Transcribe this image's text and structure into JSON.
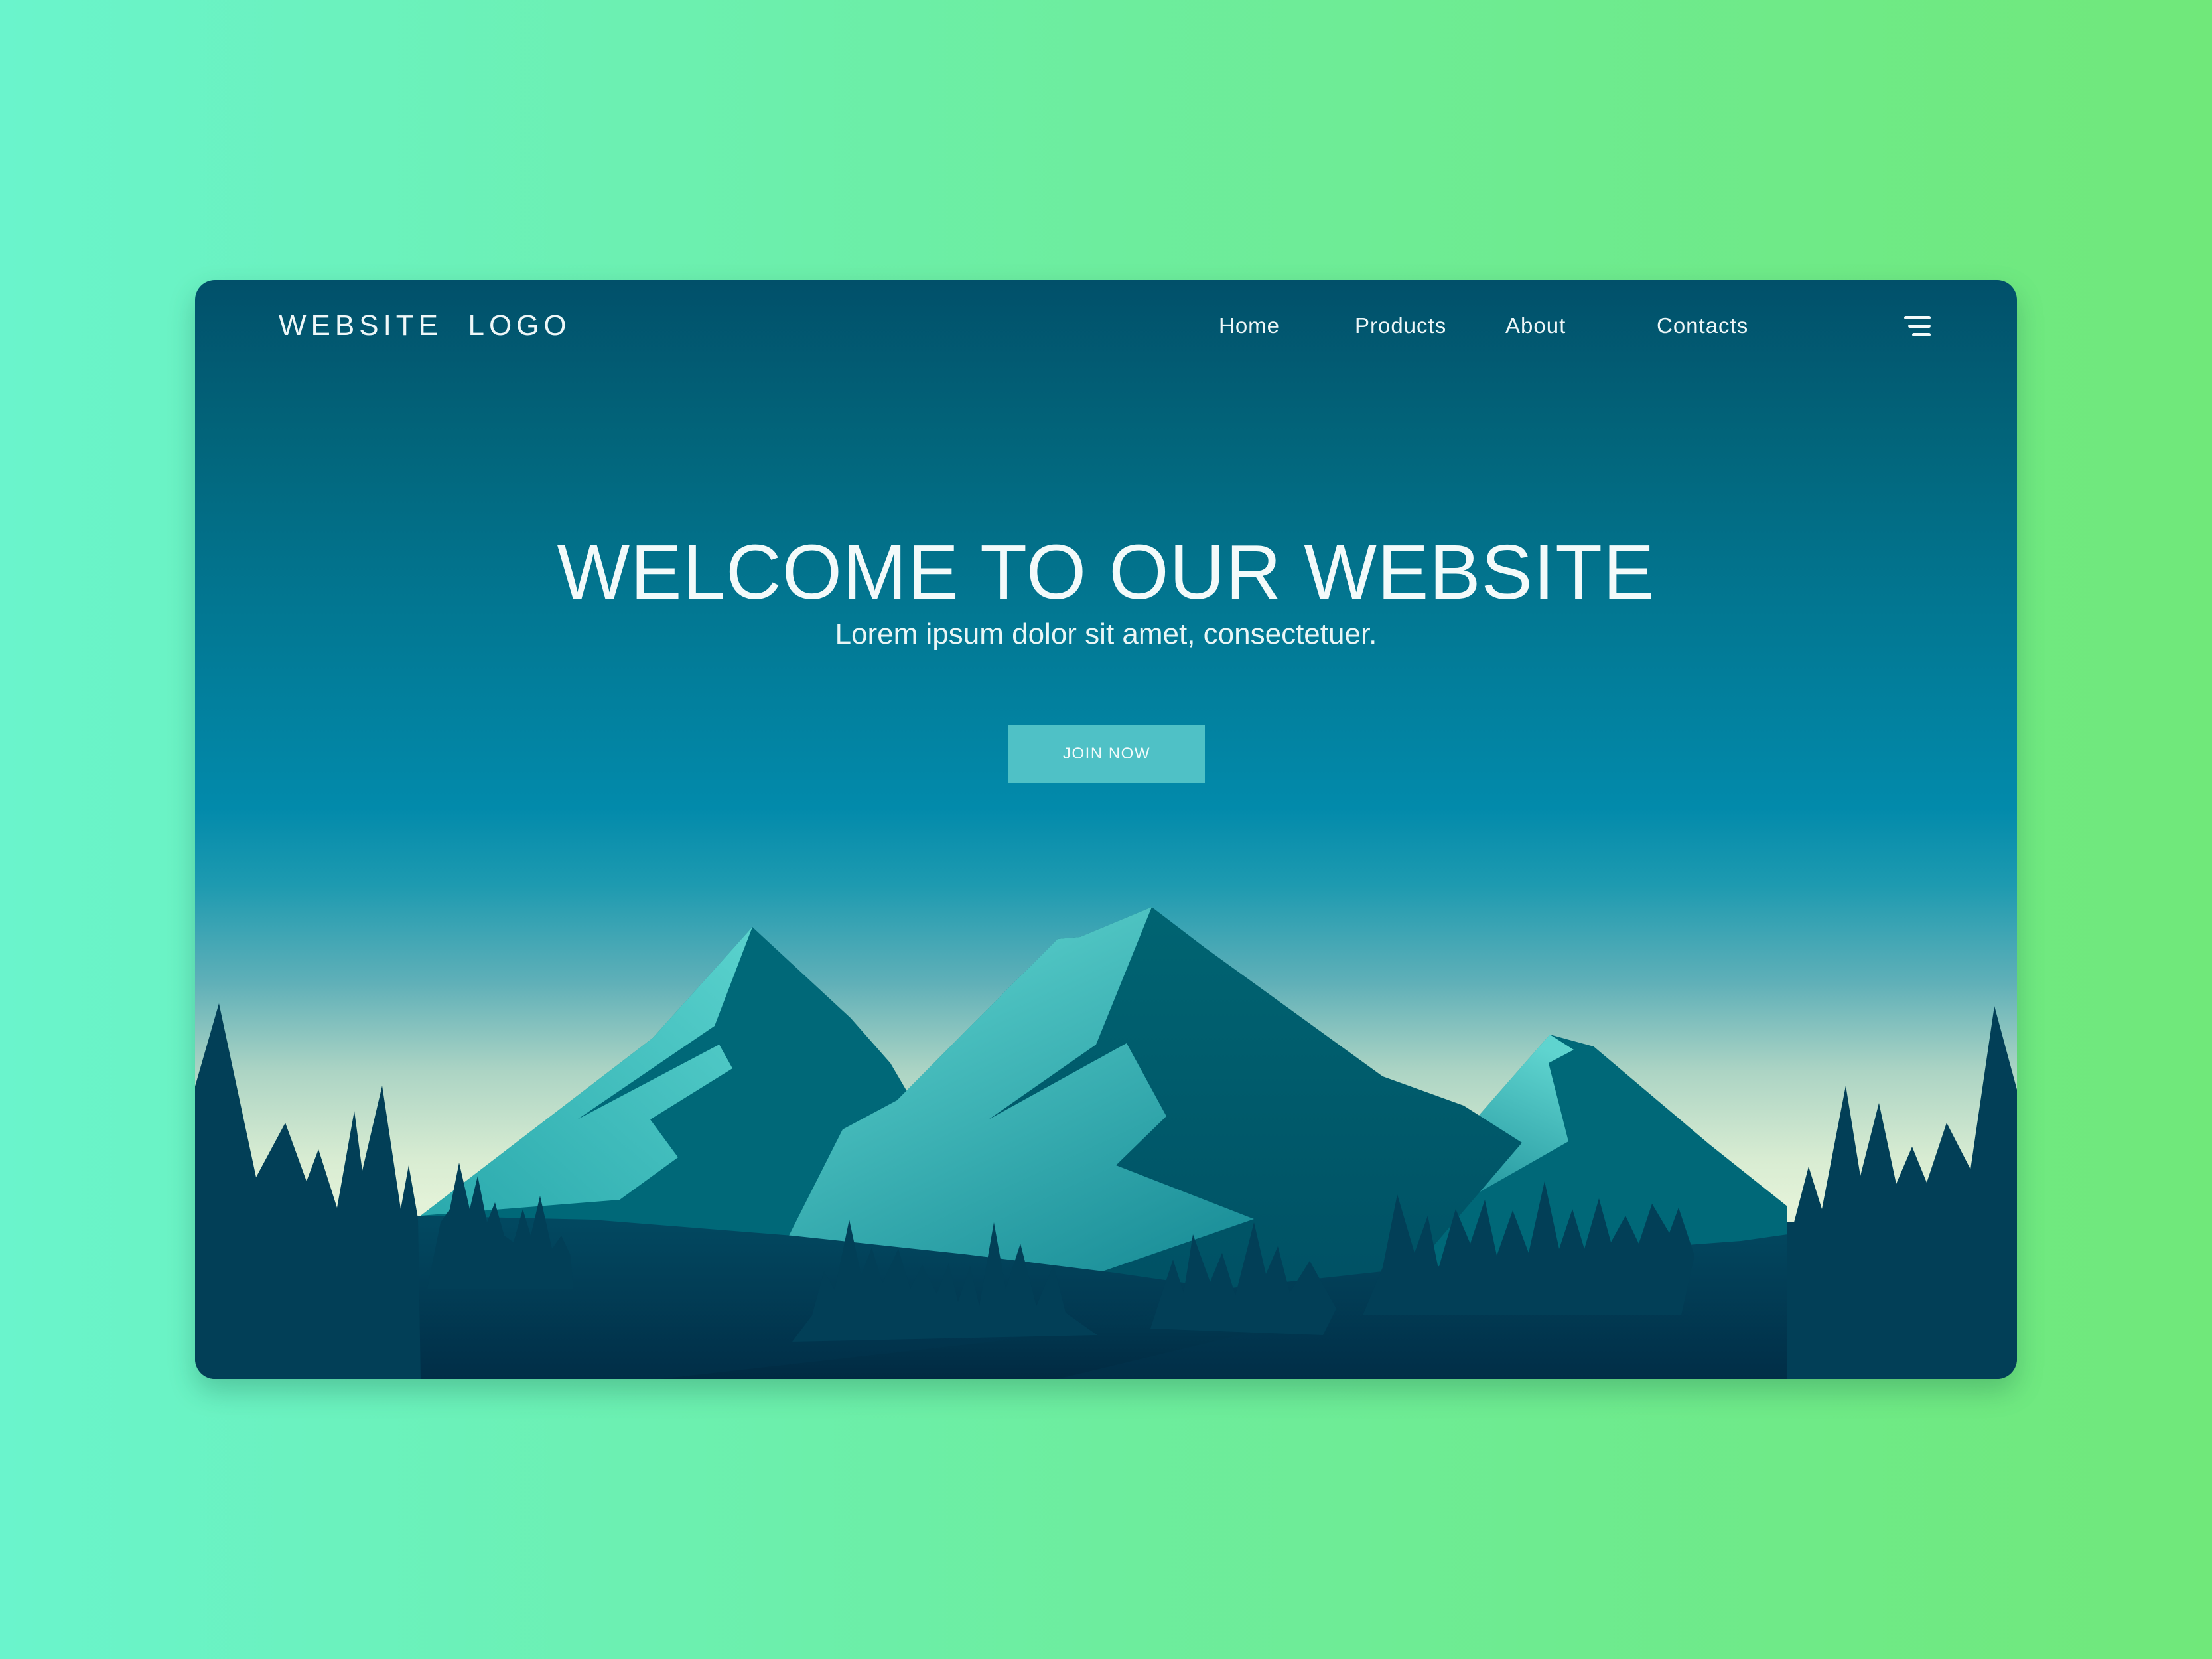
{
  "header": {
    "logo_text": "WEBSITE  LOGO",
    "nav": [
      {
        "label": "Home"
      },
      {
        "label": "Products"
      },
      {
        "label": "About"
      },
      {
        "label": "Contacts"
      }
    ],
    "menu_icon": "hamburger-menu-icon"
  },
  "hero": {
    "title": "WELCOME TO OUR WEBSITE",
    "subtitle": "Lorem ipsum dolor sit amet, consectetuer.",
    "cta_label": "JOIN NOW"
  },
  "illustration": {
    "subject": "mountain-landscape",
    "elements": [
      "mountains-icon",
      "pine-forest-icon"
    ]
  },
  "colors": {
    "page_bg_left": "#6af4cc",
    "page_bg_right": "#70e87a",
    "sky_top": "#01506a",
    "sky_mid": "#028aab",
    "horizon": "#e3f2d8",
    "mountain_light": "#5fd4cc",
    "mountain_dark": "#006674",
    "forest": "#023f57",
    "button_bg": "#4fc1c6",
    "text": "#f3fafa"
  }
}
